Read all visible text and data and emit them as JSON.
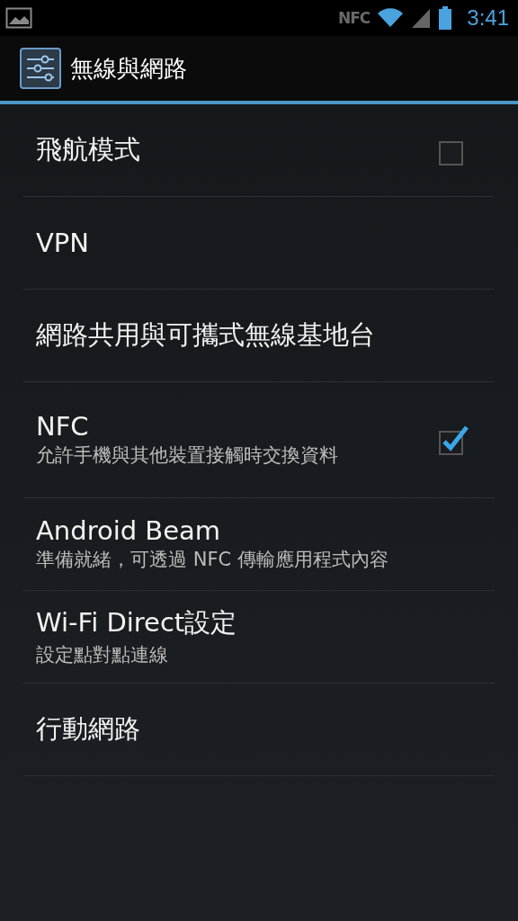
{
  "status_bar": {
    "nfc": "NFC",
    "time": "3:41"
  },
  "action_bar": {
    "title": "無線與網路"
  },
  "items": [
    {
      "kind": "checkbox",
      "title": "飛航模式",
      "checked": false
    },
    {
      "kind": "plain",
      "title": "VPN"
    },
    {
      "kind": "plain",
      "title": "網路共用與可攜式無線基地台"
    },
    {
      "kind": "checkbox",
      "title": "NFC",
      "summary": "允許手機與其他裝置接觸時交換資料",
      "checked": true
    },
    {
      "kind": "plain",
      "title": "Android Beam",
      "summary": "準備就緒，可透過 NFC 傳輸應用程式內容"
    },
    {
      "kind": "plain",
      "title": "Wi-Fi Direct設定",
      "summary": "設定點對點連線"
    },
    {
      "kind": "plain",
      "title": "行動網路"
    }
  ]
}
